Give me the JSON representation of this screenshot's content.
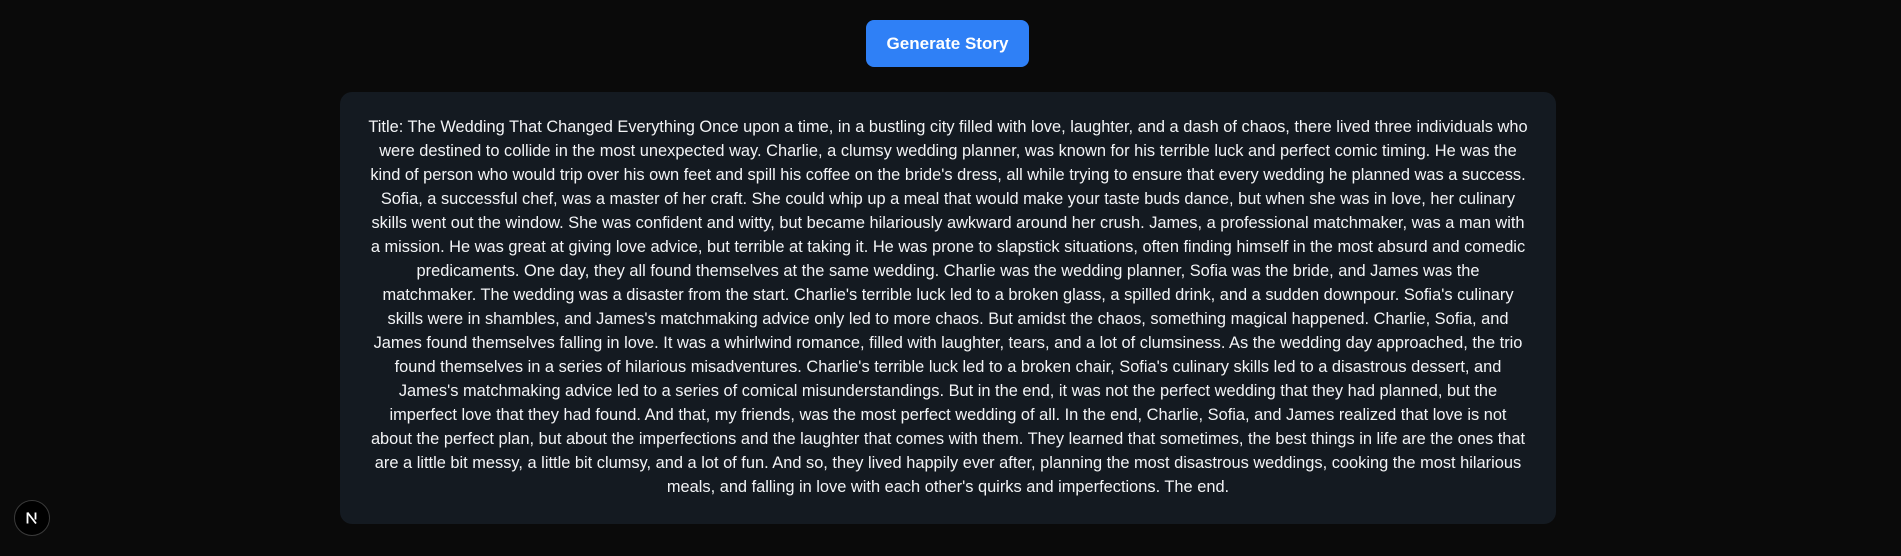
{
  "toolbar": {
    "generate_label": "Generate Story"
  },
  "story": {
    "text": "Title: The Wedding That Changed Everything Once upon a time, in a bustling city filled with love, laughter, and a dash of chaos, there lived three individuals who were destined to collide in the most unexpected way. Charlie, a clumsy wedding planner, was known for his terrible luck and perfect comic timing. He was the kind of person who would trip over his own feet and spill his coffee on the bride's dress, all while trying to ensure that every wedding he planned was a success. Sofia, a successful chef, was a master of her craft. She could whip up a meal that would make your taste buds dance, but when she was in love, her culinary skills went out the window. She was confident and witty, but became hilariously awkward around her crush. James, a professional matchmaker, was a man with a mission. He was great at giving love advice, but terrible at taking it. He was prone to slapstick situations, often finding himself in the most absurd and comedic predicaments. One day, they all found themselves at the same wedding. Charlie was the wedding planner, Sofia was the bride, and James was the matchmaker. The wedding was a disaster from the start. Charlie's terrible luck led to a broken glass, a spilled drink, and a sudden downpour. Sofia's culinary skills were in shambles, and James's matchmaking advice only led to more chaos. But amidst the chaos, something magical happened. Charlie, Sofia, and James found themselves falling in love. It was a whirlwind romance, filled with laughter, tears, and a lot of clumsiness. As the wedding day approached, the trio found themselves in a series of hilarious misadventures. Charlie's terrible luck led to a broken chair, Sofia's culinary skills led to a disastrous dessert, and James's matchmaking advice led to a series of comical misunderstandings. But in the end, it was not the perfect wedding that they had planned, but the imperfect love that they had found. And that, my friends, was the most perfect wedding of all. In the end, Charlie, Sofia, and James realized that love is not about the perfect plan, but about the imperfections and the laughter that comes with them. They learned that sometimes, the best things in life are the ones that are a little bit messy, a little bit clumsy, and a lot of fun. And so, they lived happily ever after, planning the most disastrous weddings, cooking the most hilarious meals, and falling in love with each other's quirks and imperfections. The end."
  },
  "dev_badge": {
    "icon": "nextjs-logo-icon"
  },
  "colors": {
    "background": "#0a0a0a",
    "button": "#2f80f6",
    "card": "#141a21",
    "text": "#f3f4f6"
  }
}
